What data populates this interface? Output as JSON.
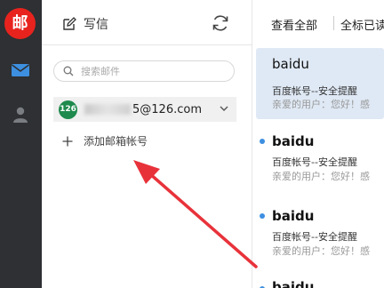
{
  "rail": {
    "logo_text": "邮",
    "icons": [
      "mail-icon",
      "contacts-icon"
    ],
    "accent": "#e8231e",
    "active_icon_color": "#3d8fe0"
  },
  "sidebar": {
    "compose_label": "写信",
    "search_placeholder": "搜索邮件",
    "account": {
      "badge": "126",
      "email_suffix": "5@126.com",
      "badge_color": "#1f8a4d"
    },
    "add_account_label": "添加邮箱帐号"
  },
  "list": {
    "header": {
      "view_all_label": "查看全部",
      "mark_read_label": "全标已读"
    },
    "mails": [
      {
        "sender": "baidu",
        "subject": "百度帐号--安全提醒",
        "preview": "亲爱的用户：您好！感",
        "unread": false,
        "selected": true
      },
      {
        "sender": "baidu",
        "subject": "百度帐号--安全提醒",
        "preview": "亲爱的用户：您好！感",
        "unread": true,
        "selected": false
      },
      {
        "sender": "baidu",
        "subject": "百度帐号--安全提醒",
        "preview": "亲爱的用户：您好！感",
        "unread": true,
        "selected": false
      },
      {
        "sender": "baidu",
        "subject": "",
        "preview": "",
        "unread": true,
        "selected": false
      }
    ]
  },
  "annotation_color": "#e8323a"
}
